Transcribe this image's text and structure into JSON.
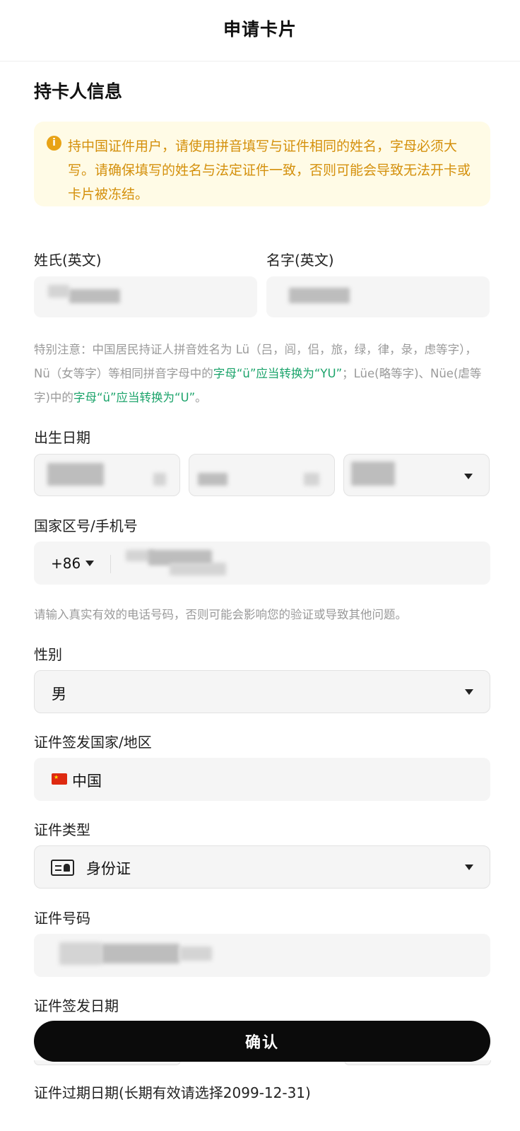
{
  "header": {
    "title": "申请卡片"
  },
  "section": {
    "title": "持卡人信息"
  },
  "notice": {
    "icon": "info-icon",
    "text": "持中国证件用户，请使用拼音填写与证件相同的姓名，字母必须大写。请确保填写的姓名与法定证件一致，否则可能会导致无法开卡或卡片被冻结。",
    "accent_color": "#d4900c"
  },
  "name": {
    "last_name_label": "姓氏(英文)",
    "first_name_label": "名字(英文)",
    "hint_part1": "特别注意：中国居民持证人拼音姓名为 Lü（吕，闾，侣，旅，绿，律，彔，虑等字），Nü（女等字）等相同拼音字母中的",
    "hint_green1": "字母“ü”应当转换为“YU”",
    "hint_part2": "；Lüe(略等字)、Nüe(虐等字)中的",
    "hint_green2": "字母“ü”应当转换为“U”",
    "hint_part3": "。"
  },
  "birth": {
    "label": "出生日期"
  },
  "phone": {
    "label": "国家区号/手机号",
    "country_code": "+86",
    "hint": "请输入真实有效的电话号码，否则可能会影响您的验证或导致其他问题。"
  },
  "gender": {
    "label": "性别",
    "value": "男"
  },
  "issue_country": {
    "label": "证件签发国家/地区",
    "value": "中国"
  },
  "id_type": {
    "label": "证件类型",
    "value": "身份证"
  },
  "id_number": {
    "label": "证件号码"
  },
  "issue_date": {
    "label": "证件签发日期"
  },
  "confirm": {
    "label": "确认"
  },
  "expiry_date": {
    "label": "证件过期日期(长期有效请选择2099-12-31)"
  }
}
